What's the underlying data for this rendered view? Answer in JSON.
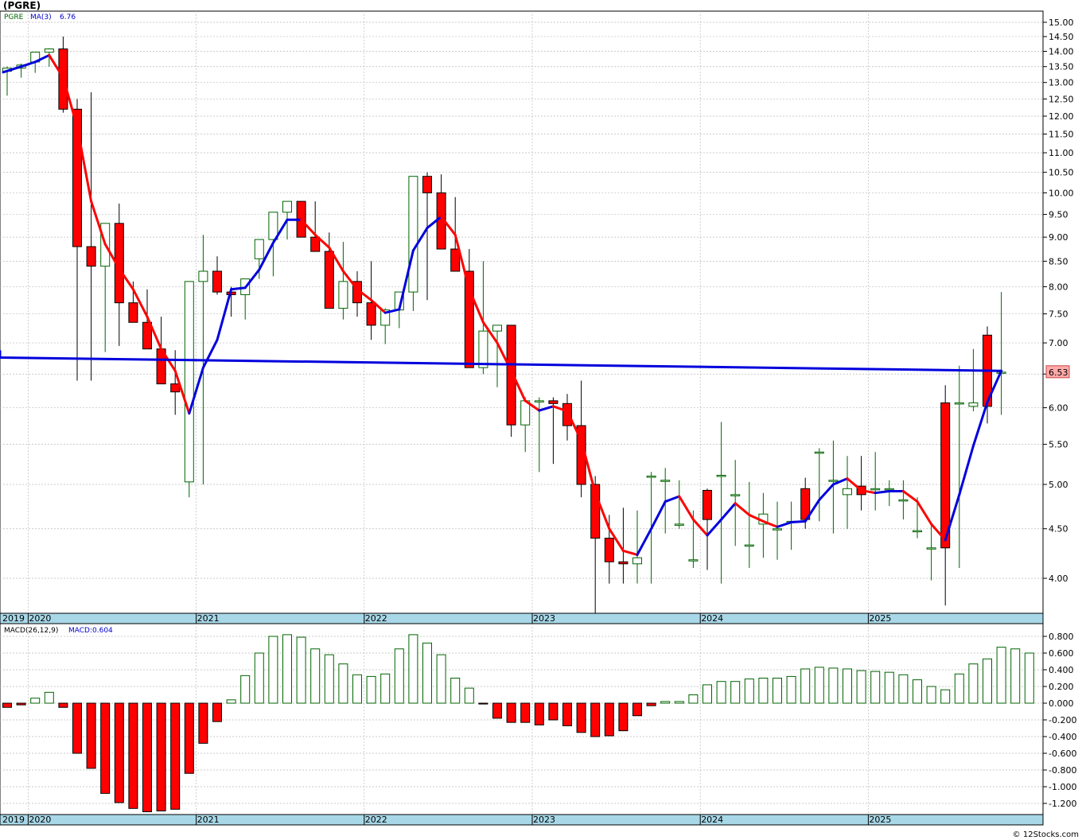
{
  "header": {
    "title": "(PGRE)"
  },
  "price_panel": {
    "legend_symbol": "PGRE",
    "legend_ma": "MA(3)",
    "legend_ma_value": "6.76",
    "last_price_label": "6.53",
    "y_ticks": [
      "15.00",
      "14.50",
      "14.00",
      "13.50",
      "13.00",
      "12.50",
      "12.00",
      "11.50",
      "11.00",
      "10.50",
      "10.00",
      "9.50",
      "9.00",
      "8.50",
      "8.00",
      "7.50",
      "7.00",
      "6.50",
      "6.00",
      "5.50",
      "5.00",
      "4.50",
      "4.00"
    ]
  },
  "macd_panel": {
    "legend_name": "MACD(26,12,9)",
    "legend_value": "MACD:0.604",
    "y_ticks": [
      "0.800",
      "0.600",
      "0.400",
      "0.200",
      "0.000",
      "-0.200",
      "-0.400",
      "-0.600",
      "-0.800",
      "-1.000",
      "-1.200"
    ]
  },
  "x_axis": {
    "year_labels": [
      "2019",
      "2020",
      "2021",
      "2022",
      "2023",
      "2024",
      "2025"
    ]
  },
  "footer": {
    "credit": "© 12Stocks.com"
  },
  "colors": {
    "down": "#ff0000",
    "up_outline": "#006400",
    "ma_up": "#0000dd",
    "ma_down": "#ff0000",
    "axis_band": "#a8d8e8"
  },
  "chart_data": [
    {
      "type": "candlestick",
      "symbol": "PGRE",
      "scale": "log",
      "ylim": [
        3.62,
        15.3
      ],
      "x": [
        "2019-11",
        "2019-12",
        "2020-01",
        "2020-02",
        "2020-03",
        "2020-04",
        "2020-05",
        "2020-06",
        "2020-07",
        "2020-08",
        "2020-09",
        "2020-10",
        "2020-11",
        "2020-12",
        "2021-01",
        "2021-02",
        "2021-03",
        "2021-04",
        "2021-05",
        "2021-06",
        "2021-07",
        "2021-08",
        "2021-09",
        "2021-10",
        "2021-11",
        "2021-12",
        "2022-01",
        "2022-02",
        "2022-03",
        "2022-04",
        "2022-05",
        "2022-06",
        "2022-07",
        "2022-08",
        "2022-09",
        "2022-10",
        "2022-11",
        "2022-12",
        "2023-01",
        "2023-02",
        "2023-03",
        "2023-04",
        "2023-05",
        "2023-06",
        "2023-07",
        "2023-08",
        "2023-09",
        "2023-10",
        "2023-11",
        "2023-12",
        "2024-01",
        "2024-02",
        "2024-03",
        "2024-04",
        "2024-05",
        "2024-06",
        "2024-07",
        "2024-08",
        "2024-09",
        "2024-10",
        "2024-11",
        "2024-12",
        "2025-01",
        "2025-02",
        "2025-03",
        "2025-04",
        "2025-05",
        "2025-06",
        "2025-07",
        "2025-08",
        "2025-09",
        "2025-10"
      ],
      "open": [
        13.35,
        13.45,
        13.65,
        13.97,
        14.08,
        12.2,
        8.8,
        8.4,
        9.3,
        7.7,
        7.35,
        6.9,
        6.35,
        5.03,
        8.1,
        8.3,
        7.9,
        7.85,
        8.55,
        8.95,
        9.55,
        9.8,
        9.0,
        8.7,
        7.6,
        8.1,
        7.7,
        7.3,
        7.57,
        7.9,
        10.4,
        10.0,
        8.75,
        8.3,
        6.6,
        7.2,
        7.3,
        5.76,
        6.1,
        6.1,
        6.06,
        5.75,
        5.0,
        4.4,
        4.16,
        4.14,
        5.1,
        5.05,
        4.55,
        4.18,
        4.93,
        5.11,
        4.88,
        4.33,
        4.55,
        4.5,
        4.58,
        4.95,
        5.4,
        5.05,
        4.88,
        4.98,
        4.95,
        4.95,
        4.82,
        4.48,
        4.3,
        6.07,
        6.07,
        6.02,
        7.13,
        6.53
      ],
      "high": [
        13.5,
        13.6,
        13.9,
        14.1,
        14.5,
        12.5,
        12.7,
        9.05,
        9.75,
        8.1,
        7.95,
        7.45,
        6.88,
        7.05,
        9.05,
        8.6,
        8.0,
        8.1,
        8.9,
        9.5,
        9.7,
        9.7,
        9.8,
        9.1,
        8.9,
        8.3,
        8.5,
        7.6,
        7.62,
        8.3,
        10.5,
        10.45,
        9.9,
        8.75,
        8.5,
        7.3,
        7.3,
        6.15,
        6.15,
        6.15,
        6.2,
        6.4,
        5.1,
        4.65,
        4.73,
        4.7,
        5.15,
        5.2,
        5.05,
        4.7,
        4.95,
        5.8,
        5.3,
        5.03,
        4.9,
        4.8,
        4.8,
        5.08,
        5.45,
        5.55,
        5.35,
        5.35,
        5.4,
        5.05,
        5.05,
        4.85,
        4.55,
        6.33,
        6.63,
        6.9,
        7.28,
        7.9
      ],
      "low": [
        12.6,
        13.15,
        13.3,
        13.5,
        12.1,
        6.4,
        6.4,
        6.85,
        6.95,
        7.35,
        7.15,
        6.45,
        5.9,
        4.85,
        5.0,
        7.85,
        7.45,
        7.4,
        8.15,
        8.2,
        8.95,
        9.05,
        8.75,
        7.9,
        7.4,
        7.45,
        7.05,
        6.98,
        7.25,
        7.55,
        7.75,
        9.45,
        8.55,
        7.7,
        6.5,
        6.3,
        5.6,
        5.4,
        5.15,
        5.25,
        5.55,
        4.85,
        3.6,
        3.95,
        3.95,
        3.95,
        3.95,
        4.45,
        4.5,
        4.1,
        4.08,
        3.95,
        4.32,
        4.1,
        4.2,
        4.18,
        4.28,
        4.5,
        4.58,
        4.45,
        4.5,
        4.7,
        4.7,
        4.75,
        4.6,
        4.4,
        3.98,
        3.75,
        4.1,
        5.95,
        5.78,
        5.9
      ],
      "close": [
        13.45,
        13.55,
        13.97,
        14.08,
        12.2,
        8.8,
        8.4,
        9.3,
        7.7,
        7.35,
        6.9,
        6.35,
        6.23,
        8.1,
        8.3,
        7.9,
        7.85,
        8.15,
        8.95,
        9.55,
        9.8,
        9.0,
        8.7,
        7.6,
        8.1,
        7.7,
        7.3,
        7.57,
        7.9,
        10.4,
        10.0,
        8.75,
        8.3,
        6.6,
        7.2,
        7.3,
        5.76,
        6.1,
        6.1,
        6.06,
        5.75,
        5.0,
        4.4,
        4.16,
        4.14,
        4.2,
        5.1,
        5.05,
        4.55,
        4.18,
        4.6,
        5.11,
        4.88,
        4.33,
        4.66,
        4.5,
        4.58,
        4.6,
        5.4,
        5.05,
        4.95,
        4.88,
        4.95,
        4.95,
        4.82,
        4.48,
        4.3,
        4.3,
        6.07,
        6.07,
        6.02,
        6.53
      ]
    },
    {
      "type": "line",
      "name": "MA(3)",
      "x": [
        "2019-11",
        "2019-12",
        "2020-01",
        "2020-02",
        "2020-03",
        "2020-04",
        "2020-05",
        "2020-06",
        "2020-07",
        "2020-08",
        "2020-09",
        "2020-10",
        "2020-11",
        "2020-12",
        "2021-01",
        "2021-02",
        "2021-03",
        "2021-04",
        "2021-05",
        "2021-06",
        "2021-07",
        "2021-08",
        "2021-09",
        "2021-10",
        "2021-11",
        "2021-12",
        "2022-01",
        "2022-02",
        "2022-03",
        "2022-04",
        "2022-05",
        "2022-06",
        "2022-07",
        "2022-08",
        "2022-09",
        "2022-10",
        "2022-11",
        "2022-12",
        "2023-01",
        "2023-02",
        "2023-03",
        "2023-04",
        "2023-05",
        "2023-06",
        "2023-07",
        "2023-08",
        "2023-09",
        "2023-10",
        "2023-11",
        "2023-12",
        "2024-01",
        "2024-02",
        "2024-03",
        "2024-04",
        "2024-05",
        "2024-06",
        "2024-07",
        "2024-08",
        "2024-09",
        "2024-10",
        "2024-11",
        "2024-12",
        "2025-01",
        "2025-02",
        "2025-03",
        "2025-04",
        "2025-05",
        "2025-06",
        "2025-07",
        "2025-08",
        "2025-09",
        "2025-10"
      ],
      "values": [
        13.32,
        13.5,
        13.65,
        13.87,
        13.15,
        11.7,
        9.8,
        8.85,
        8.35,
        7.95,
        7.45,
        6.9,
        6.55,
        5.92,
        6.6,
        7.05,
        7.95,
        7.98,
        8.33,
        8.88,
        9.38,
        9.38,
        9.05,
        8.78,
        8.3,
        7.95,
        7.75,
        7.52,
        7.58,
        8.72,
        9.2,
        9.45,
        9.05,
        7.95,
        7.35,
        7.0,
        6.55,
        6.1,
        5.96,
        6.02,
        5.95,
        5.55,
        4.9,
        4.5,
        4.27,
        4.23,
        4.5,
        4.8,
        4.86,
        4.6,
        4.43,
        4.6,
        4.78,
        4.65,
        4.58,
        4.52,
        4.57,
        4.58,
        4.82,
        5.0,
        5.07,
        4.93,
        4.9,
        4.92,
        4.92,
        4.8,
        4.55,
        4.38,
        4.88,
        5.48,
        6.08,
        6.55,
        6.76
      ],
      "note": "first value is the MA at the left edge of the plot"
    },
    {
      "type": "bar",
      "name": "MACD(26,12,9)",
      "x": [
        "2019-11",
        "2019-12",
        "2020-01",
        "2020-02",
        "2020-03",
        "2020-04",
        "2020-05",
        "2020-06",
        "2020-07",
        "2020-08",
        "2020-09",
        "2020-10",
        "2020-11",
        "2020-12",
        "2021-01",
        "2021-02",
        "2021-03",
        "2021-04",
        "2021-05",
        "2021-06",
        "2021-07",
        "2021-08",
        "2021-09",
        "2021-10",
        "2021-11",
        "2021-12",
        "2022-01",
        "2022-02",
        "2022-03",
        "2022-04",
        "2022-05",
        "2022-06",
        "2022-07",
        "2022-08",
        "2022-09",
        "2022-10",
        "2022-11",
        "2022-12",
        "2023-01",
        "2023-02",
        "2023-03",
        "2023-04",
        "2023-05",
        "2023-06",
        "2023-07",
        "2023-08",
        "2023-09",
        "2023-10",
        "2023-11",
        "2023-12",
        "2024-01",
        "2024-02",
        "2024-03",
        "2024-04",
        "2024-05",
        "2024-06",
        "2024-07",
        "2024-08",
        "2024-09",
        "2024-10",
        "2024-11",
        "2024-12",
        "2025-01",
        "2025-02",
        "2025-03",
        "2025-04",
        "2025-05",
        "2025-06",
        "2025-07",
        "2025-08",
        "2025-09",
        "2025-10"
      ],
      "values": [
        -0.05,
        -0.02,
        0.06,
        0.13,
        -0.05,
        -0.6,
        -0.78,
        -1.08,
        -1.19,
        -1.26,
        -1.3,
        -1.29,
        -1.27,
        -0.84,
        -0.48,
        -0.22,
        0.04,
        0.33,
        0.6,
        0.8,
        0.82,
        0.79,
        0.65,
        0.58,
        0.47,
        0.34,
        0.32,
        0.35,
        0.65,
        0.82,
        0.72,
        0.58,
        0.3,
        0.18,
        -0.01,
        -0.18,
        -0.23,
        -0.23,
        -0.26,
        -0.2,
        -0.27,
        -0.35,
        -0.4,
        -0.39,
        -0.33,
        -0.15,
        -0.03,
        0.02,
        0.02,
        0.1,
        0.22,
        0.26,
        0.26,
        0.29,
        0.3,
        0.3,
        0.32,
        0.41,
        0.43,
        0.42,
        0.41,
        0.39,
        0.38,
        0.37,
        0.34,
        0.28,
        0.2,
        0.16,
        0.35,
        0.47,
        0.53,
        0.67,
        0.65,
        0.6
      ],
      "ylim": [
        -1.33,
        0.85
      ]
    }
  ]
}
